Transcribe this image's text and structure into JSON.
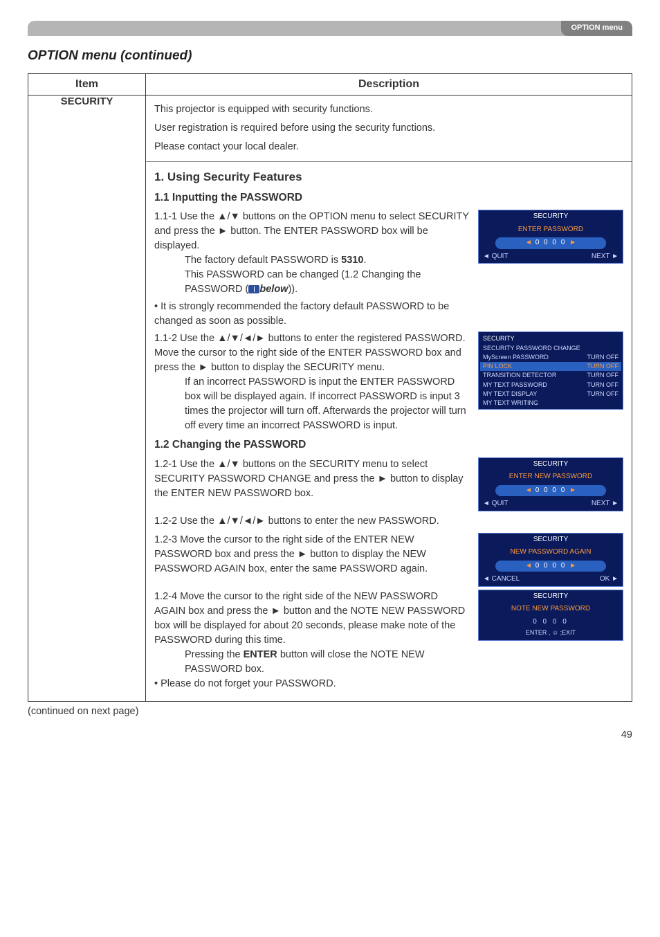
{
  "header": {
    "tab": "OPTION menu"
  },
  "section_title": "OPTION menu (continued)",
  "table": {
    "headers": {
      "item": "Item",
      "description": "Description"
    },
    "item_label": "SECURITY",
    "intro": {
      "l1": "This projector is equipped with security functions.",
      "l2": "User registration is required before using the security functions.",
      "l3": "Please contact your local dealer."
    },
    "h1": "1. Using Security Features",
    "h2a": "1.1 Inputting the PASSWORD",
    "p111": {
      "num": "1.1-1",
      "t1": "Use the ▲/▼ buttons on the OPTION menu to select SECURITY and press the ► button. The ENTER PASSWORD box will be displayed.",
      "t2a": "The factory default PASSWORD is ",
      "t2b": "5310",
      "t2c": ".",
      "t3": "This PASSWORD can be changed (1.2 Changing the PASSWORD (",
      "t3b": "below",
      "t3c": ")).",
      "bullet": "• It is strongly recommended the factory default PASSWORD to be changed as soon as possible."
    },
    "p112": {
      "num": "1.1-2",
      "t1": "Use the ▲/▼/◄/► buttons to enter the registered PASSWORD. Move the cursor to the right side of the ENTER PASSWORD box and press the ► button to display the SECURITY menu.",
      "t2": "If an incorrect PASSWORD is input the ENTER PASSWORD box will be displayed again. If incorrect PASSWORD is input 3 times the projector will turn off. Afterwards the projector will turn off every time an incorrect PASSWORD is input."
    },
    "h2b": "1.2 Changing the PASSWORD",
    "p121": {
      "num": "1.2-1",
      "t": "Use the ▲/▼ buttons on the SECURITY menu to select SECURITY PASSWORD CHANGE and press the ► button to display the ENTER NEW PASSWORD box."
    },
    "p122": {
      "num": "1.2-2",
      "t": "Use the ▲/▼/◄/► buttons to enter the new PASSWORD."
    },
    "p123": {
      "num": "1.2-3",
      "t": "Move the cursor to the right side of the ENTER NEW PASSWORD box and press the ► button to display the NEW PASSWORD AGAIN box, enter the same PASSWORD again."
    },
    "p124": {
      "num": "1.2-4",
      "t1": "Move the cursor to the right side of the NEW PASSWORD AGAIN box and press the ► button and the NOTE NEW PASSWORD box will be displayed for about 20 seconds, please make note of the PASSWORD during this time.",
      "t2a": "Pressing the ",
      "t2b": "ENTER",
      "t2c": " button will close the NOTE NEW PASSWORD box.",
      "bullet": "• Please do not forget your PASSWORD."
    }
  },
  "osd": {
    "enter": {
      "title": "SECURITY",
      "sub": "ENTER PASSWORD",
      "code": "0 0 0 0",
      "quit": "◄ QUIT",
      "next": "NEXT ►"
    },
    "menu": {
      "title": "SECURITY",
      "rows": [
        {
          "l": "SECURITY PASSWORD CHANGE",
          "r": ""
        },
        {
          "l": "MyScreen PASSWORD",
          "r": "TURN OFF"
        },
        {
          "l": "PIN LOCK",
          "r": "TURN OFF",
          "hl": true
        },
        {
          "l": "TRANSITION DETECTOR",
          "r": "TURN OFF"
        },
        {
          "l": "MY TEXT PASSWORD",
          "r": "TURN OFF"
        },
        {
          "l": "MY TEXT DISPLAY",
          "r": "TURN OFF"
        },
        {
          "l": "MY TEXT WRITING",
          "r": ""
        }
      ]
    },
    "new": {
      "title": "SECURITY",
      "sub": "ENTER NEW PASSWORD",
      "code": "0 0 0 0",
      "quit": "◄ QUIT",
      "next": "NEXT ►"
    },
    "again": {
      "title": "SECURITY",
      "sub": "NEW PASSWORD AGAIN",
      "code": "0 0 0 0",
      "cancel": "◄ CANCEL",
      "ok": "OK ►"
    },
    "note": {
      "title": "SECURITY",
      "sub": "NOTE NEW PASSWORD",
      "code": "0 0 0 0",
      "exit": "ENTER , ☺ ;EXIT"
    }
  },
  "continued": "(continued on next page)",
  "pagenum": "49"
}
